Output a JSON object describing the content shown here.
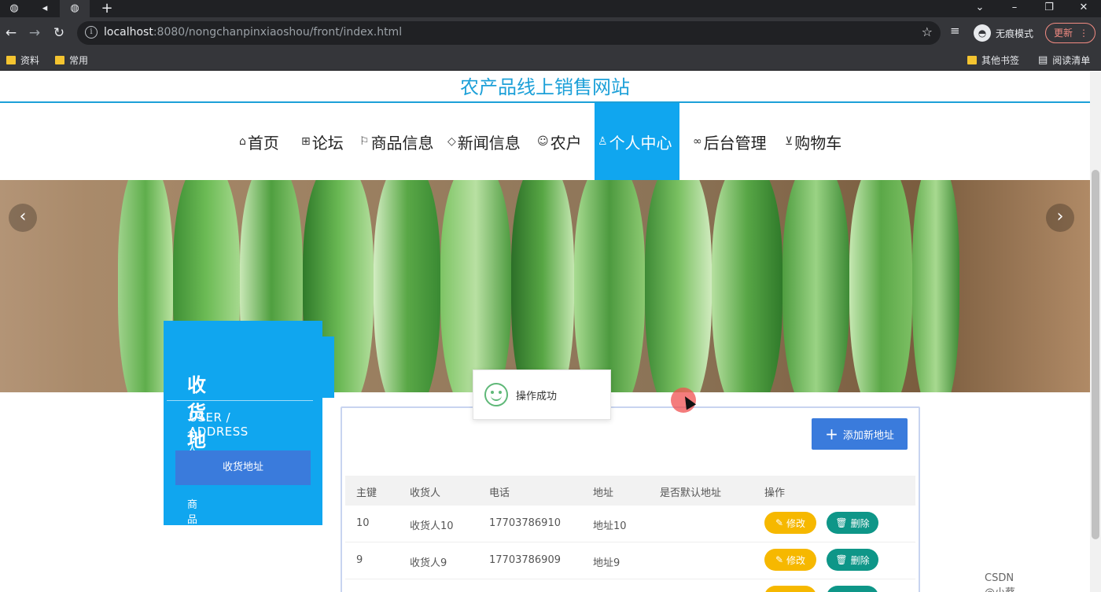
{
  "browser": {
    "url_host": "localhost",
    "url_rest": ":8080/nongchanpinxiaoshou/front/index.html",
    "incognito_label": "无痕模式",
    "update_label": "更新",
    "bookmarks": [
      "资料",
      "常用"
    ],
    "other_bookmarks": "其他书签",
    "reading_list": "阅读清单"
  },
  "site": {
    "title": "农产品线上销售网站"
  },
  "nav": {
    "items": [
      {
        "label": "首页",
        "icon": "home-icon"
      },
      {
        "label": "论坛",
        "icon": "gift-icon"
      },
      {
        "label": "商品信息",
        "icon": "flag-icon"
      },
      {
        "label": "新闻信息",
        "icon": "tag-icon"
      },
      {
        "label": "农户",
        "icon": "face-icon"
      },
      {
        "label": "个人中心",
        "icon": "user-icon"
      },
      {
        "label": "后台管理",
        "icon": "link-icon"
      },
      {
        "label": "购物车",
        "icon": "cart-icon"
      }
    ],
    "active": "个人中心"
  },
  "toast": {
    "message": "操作成功"
  },
  "sidebar": {
    "title": "收货地址",
    "subtitle_en": "USER / ADDRESS",
    "subtitle_cn": "个人中心",
    "menu": [
      "收货地址",
      "商品订单"
    ]
  },
  "main": {
    "add_button": "添加新地址",
    "columns": [
      "主键",
      "收货人",
      "电话",
      "地址",
      "是否默认地址",
      "操作"
    ],
    "rows": [
      {
        "id": "10",
        "name": "收货人10",
        "phone": "17703786910",
        "address": "地址10",
        "default": ""
      },
      {
        "id": "9",
        "name": "收货人9",
        "phone": "17703786909",
        "address": "地址9",
        "default": ""
      }
    ],
    "edit_label": "修改",
    "delete_label": "删除"
  },
  "watermark": "CSDN @小蔡coding",
  "colors": {
    "accent": "#10a6ef",
    "primary_button": "#3a7bdc",
    "edit_button": "#f6b800",
    "delete_button": "#0e9688",
    "site_title": "#1ca0d8"
  }
}
